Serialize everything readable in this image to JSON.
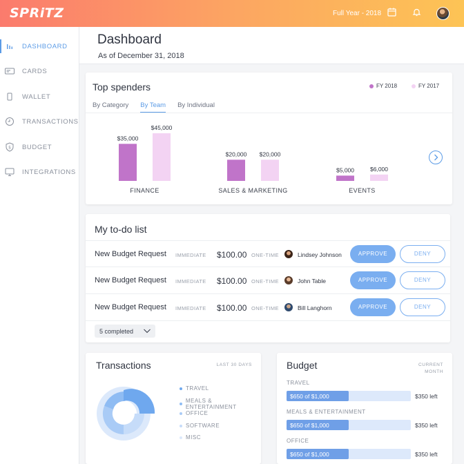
{
  "app": {
    "logo": "SPRiTZ",
    "period": "Full Year - 2018"
  },
  "colors": {
    "accent": "#5b9be6",
    "fy2018": "#c074c9",
    "fy2017": "#f3d3f3",
    "approve": "#7aaef0"
  },
  "sidebar": {
    "items": [
      {
        "label": "DASHBOARD",
        "icon": "bar-chart-icon",
        "active": true
      },
      {
        "label": "CARDS",
        "icon": "card-icon"
      },
      {
        "label": "WALLET",
        "icon": "phone-icon"
      },
      {
        "label": "TRANSACTIONS",
        "icon": "clock-icon"
      },
      {
        "label": "BUDGET",
        "icon": "shield-dollar-icon"
      },
      {
        "label": "INTEGRATIONS",
        "icon": "monitor-icon"
      }
    ]
  },
  "header": {
    "title": "Dashboard",
    "subtitle": "As of December 31, 2018"
  },
  "spenders": {
    "title": "Top spenders",
    "legend": [
      "FY 2018",
      "FY 2017"
    ],
    "tabs": [
      "By Category",
      "By Team",
      "By Individual"
    ],
    "active_tab": "By Team"
  },
  "chart_data": {
    "type": "bar",
    "categories": [
      "FINANCE",
      "SALES & MARKETING",
      "EVENTS"
    ],
    "series": [
      {
        "name": "FY 2018",
        "values": [
          35000,
          20000,
          5000
        ]
      },
      {
        "name": "FY 2017",
        "values": [
          45000,
          20000,
          6000
        ]
      }
    ],
    "data_labels": [
      [
        "$35,000",
        "$20,000",
        "$5,000"
      ],
      [
        "$45,000",
        "$20,000",
        "$6,000"
      ]
    ]
  },
  "todo": {
    "title": "My to-do list",
    "approve_label": "APPROVE",
    "deny_label": "DENY",
    "rows": [
      {
        "title": "New Budget Request",
        "priority": "IMMEDIATE",
        "amount": "$100.00",
        "frequency": "ONE-TIME",
        "person": "Lindsey Johnson"
      },
      {
        "title": "New Budget Request",
        "priority": "IMMEDIATE",
        "amount": "$100.00",
        "frequency": "ONE-TIME",
        "person": "John Table"
      },
      {
        "title": "New Budget Request",
        "priority": "IMMEDIATE",
        "amount": "$100.00",
        "frequency": "ONE-TIME",
        "person": "Bill Langhorn"
      }
    ],
    "completed_label": "5 completed"
  },
  "transactions": {
    "title": "Transactions",
    "period": "LAST 30 DAYS",
    "legend": [
      {
        "label": "TRAVEL",
        "color": "#6fa8ee"
      },
      {
        "label": "MEALS & ENTERTAINMENT",
        "color": "#8fbcf3"
      },
      {
        "label": "OFFICE",
        "color": "#a9cbf6"
      },
      {
        "label": "SOFTWARE",
        "color": "#c6dcf9"
      },
      {
        "label": "MISC",
        "color": "#dce9fb"
      }
    ]
  },
  "budget": {
    "title": "Budget",
    "period_line1": "CURRENT",
    "period_line2": "MONTH",
    "rows": [
      {
        "category": "TRAVEL",
        "spent_label": "$650 of $1,000",
        "left": "$350 left",
        "fraction": 0.5
      },
      {
        "category": "MEALS & ENTERTAINMENT",
        "spent_label": "$650 of $1,000",
        "left": "$350 left",
        "fraction": 0.5
      },
      {
        "category": "OFFICE",
        "spent_label": "$650 of $1,000",
        "left": "$350 left",
        "fraction": 0.5
      }
    ]
  }
}
